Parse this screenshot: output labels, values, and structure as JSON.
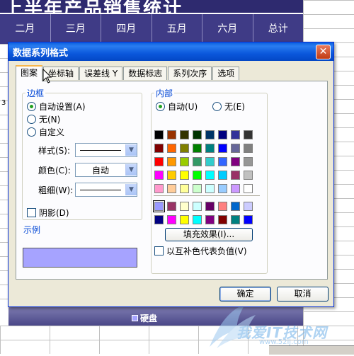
{
  "sheet": {
    "title": "上半年产品销售统计",
    "months": [
      "二月",
      "三月",
      "四月",
      "五月",
      "六月",
      "总计"
    ],
    "left_fragment": "3",
    "legend_label": "硬盘",
    "legend_color": "#a6a3ff"
  },
  "watermark": {
    "text": "我爱IT技术网",
    "url": "www.52ij.com"
  },
  "dialog": {
    "title": "数据系列格式",
    "close_glyph": "✕",
    "tabs": [
      {
        "label": "图案",
        "active": true
      },
      {
        "label": "坐标轴",
        "active": false
      },
      {
        "label": "误差线 Y",
        "active": false
      },
      {
        "label": "数据标志",
        "active": false
      },
      {
        "label": "系列次序",
        "active": false
      },
      {
        "label": "选项",
        "active": false
      }
    ],
    "border_group": {
      "title": "边框",
      "auto": "自动设置(A)",
      "none": "无(N)",
      "custom": "自定义",
      "selected": "auto",
      "style_label": "样式(S):",
      "color_label": "颜色(C):",
      "color_value": "自动",
      "weight_label": "粗细(W):",
      "shadow_label": "阴影(D)"
    },
    "area_group": {
      "title": "内部",
      "auto": "自动(U)",
      "none": "无(E)",
      "selected": "auto",
      "fill_button": "填充效果(I)...",
      "invert_label": "以互补色代表负值(V)",
      "palette": [
        "#000000",
        "#993300",
        "#333300",
        "#003300",
        "#003366",
        "#000080",
        "#333399",
        "#333333",
        "#800000",
        "#ff6600",
        "#808000",
        "#008000",
        "#008080",
        "#0000ff",
        "#666699",
        "#808080",
        "#ff0000",
        "#ff9900",
        "#99cc00",
        "#339966",
        "#33cccc",
        "#3366ff",
        "#800080",
        "#969696",
        "#ff00ff",
        "#ffcc00",
        "#ffff00",
        "#00ff00",
        "#00ffff",
        "#00ccff",
        "#993366",
        "#c0c0c0",
        "#ff99cc",
        "#ffcc99",
        "#ffff99",
        "#ccffcc",
        "#ccffff",
        "#99ccff",
        "#cc99ff",
        "#ffffff"
      ],
      "chart_palette": [
        "#9999ff",
        "#993366",
        "#ffffcc",
        "#ccffff",
        "#660066",
        "#ff8080",
        "#0066cc",
        "#ccccff",
        "#000080",
        "#ff00ff",
        "#ffff00",
        "#00ffff",
        "#800080",
        "#800000",
        "#008080",
        "#0000ff"
      ],
      "selected_swatch": "#9999ff"
    },
    "sample_group": {
      "title": "示例",
      "color": "#a6a3ff"
    },
    "ok_label": "确定",
    "cancel_label": "取消"
  }
}
